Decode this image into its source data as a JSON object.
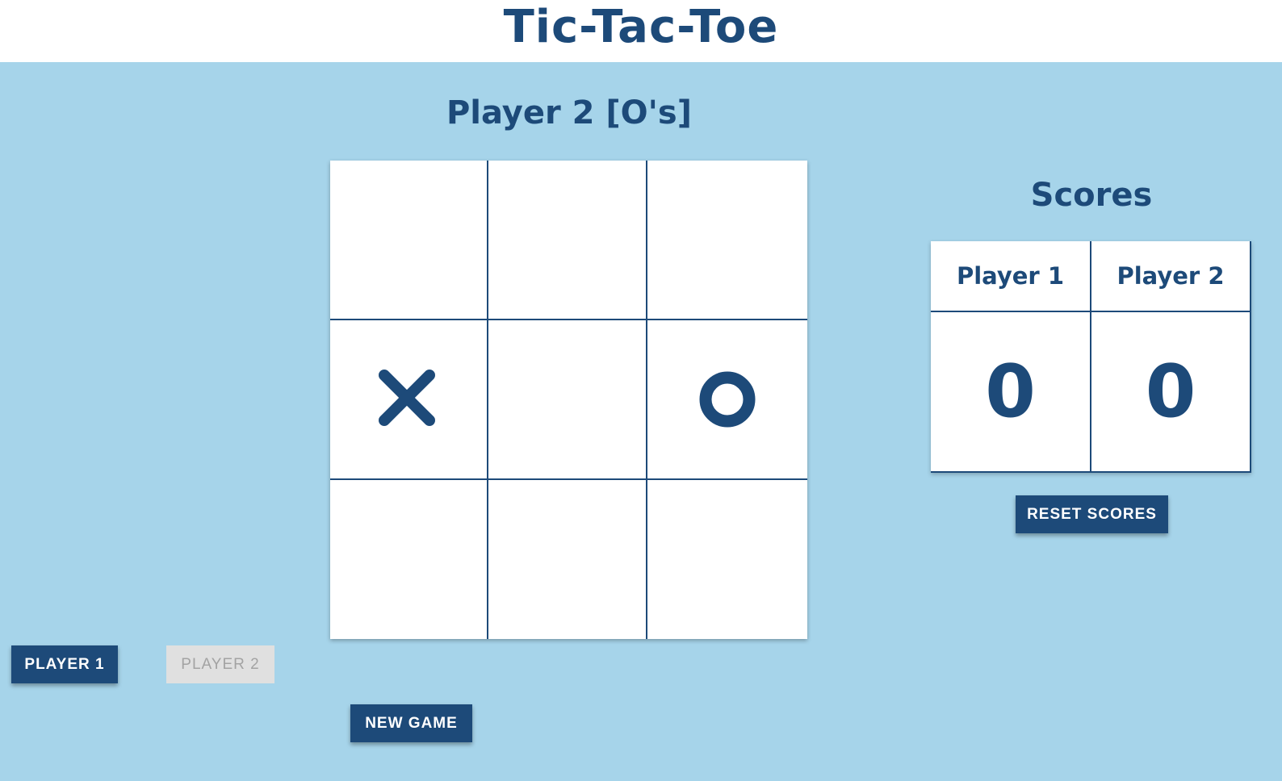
{
  "header": {
    "title": "Tic-Tac-Toe"
  },
  "game": {
    "turn_label": "Player 2 [O's]",
    "board": [
      [
        "",
        "",
        ""
      ],
      [
        "X",
        "",
        "O"
      ],
      [
        "",
        "",
        ""
      ]
    ]
  },
  "scores": {
    "title": "Scores",
    "player1_label": "Player 1",
    "player2_label": "Player 2",
    "player1_score": "0",
    "player2_score": "0",
    "reset_label": "RESET SCORES"
  },
  "controls": {
    "player1_label": "PLAYER 1",
    "player2_label": "PLAYER 2",
    "new_game_label": "NEW GAME"
  },
  "colors": {
    "background": "#a6d4ea",
    "primary": "#1d4a79",
    "board": "#ffffff",
    "disabled_bg": "#e0e0e0",
    "disabled_text": "#a3a3a3"
  },
  "icons": {
    "x_mark": "x-mark-icon",
    "o_mark": "o-mark-icon"
  }
}
